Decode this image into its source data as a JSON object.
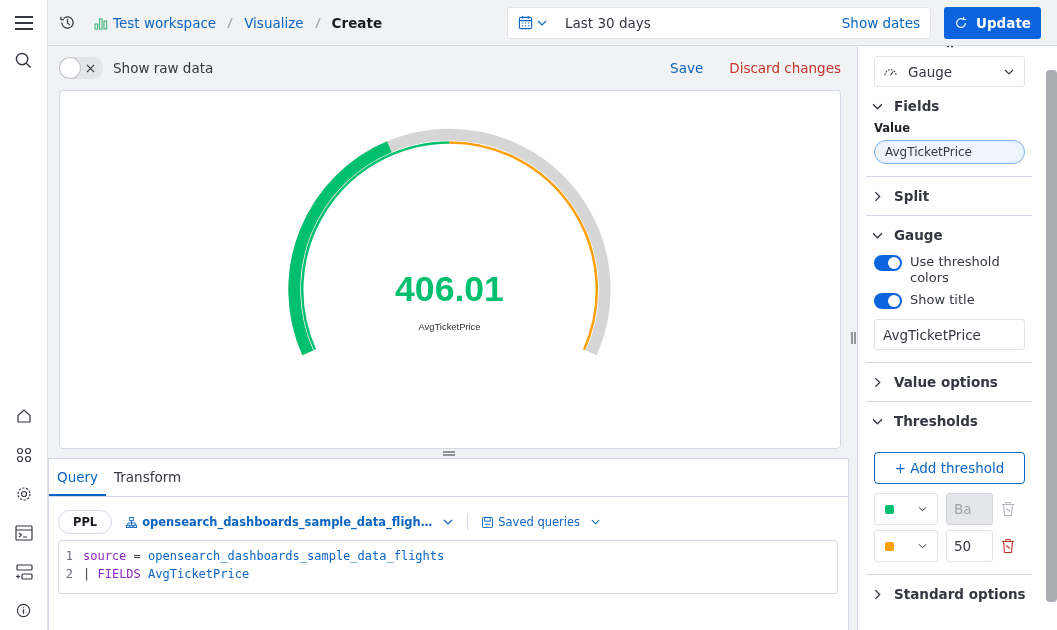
{
  "breadcrumbs": [
    {
      "label": "Test workspace",
      "kind": "workspace"
    },
    {
      "label": "Visualize",
      "kind": "link"
    },
    {
      "label": "Create",
      "kind": "current"
    }
  ],
  "date_picker": {
    "range": "Last 30 days",
    "show_dates": "Show dates"
  },
  "update_button": "Update",
  "toolbar": {
    "raw_data_toggle": {
      "label": "Show raw data",
      "on": false
    },
    "save": "Save",
    "discard": "Discard changes"
  },
  "gauge": {
    "value": "406.01",
    "title": "AvgTicketPrice",
    "level": 0.4
  },
  "query": {
    "tabs": [
      {
        "label": "Query",
        "selected": true
      },
      {
        "label": "Transform",
        "selected": false
      }
    ],
    "language": "PPL",
    "data_source": "opensearch_dashboards_sample_data_fligh…",
    "saved_queries": "Saved queries",
    "lines": [
      {
        "number": "1",
        "tokens": [
          {
            "text": "source",
            "kind": "keyword"
          },
          {
            "text": " = ",
            "kind": "plain"
          },
          {
            "text": "opensearch_dashboards_sample_data_flights",
            "kind": "ident"
          }
        ]
      },
      {
        "number": "2",
        "tokens": [
          {
            "text": "| ",
            "kind": "plain"
          },
          {
            "text": "FIELDS",
            "kind": "keyword"
          },
          {
            "text": " AvgTicketPrice",
            "kind": "ident"
          }
        ]
      }
    ]
  },
  "panel": {
    "vis_type": "Gauge",
    "sections": [
      {
        "kind": "fields",
        "title": "Fields",
        "expanded": true,
        "value_label": "Value",
        "value": "AvgTicketPrice"
      },
      {
        "kind": "plain",
        "title": "Split",
        "expanded": false
      },
      {
        "kind": "gauge",
        "title": "Gauge",
        "expanded": true,
        "toggles": [
          {
            "label": "Use threshold colors",
            "on": true
          },
          {
            "label": "Show title",
            "on": true
          }
        ],
        "title_value": "AvgTicketPrice"
      },
      {
        "kind": "plain",
        "title": "Value options",
        "expanded": false
      },
      {
        "kind": "thresholds",
        "title": "Thresholds",
        "expanded": true,
        "add_button": "+ Add threshold",
        "items": [
          {
            "color": "#00bf6f",
            "value": "Ba",
            "disabled": true
          },
          {
            "color": "#ff9f0a",
            "value": "50",
            "disabled": false
          }
        ]
      },
      {
        "kind": "plain",
        "title": "Standard options",
        "expanded": false
      }
    ]
  }
}
